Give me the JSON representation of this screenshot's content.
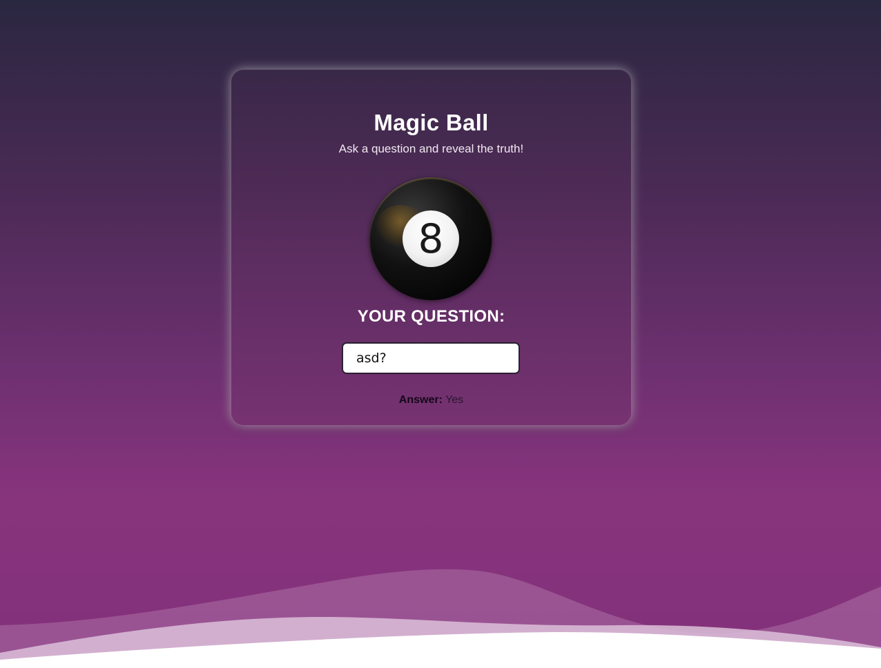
{
  "app": {
    "title": "Magic Ball",
    "subtitle": "Ask a question and reveal the truth!"
  },
  "ball": {
    "icon": "eight-ball-icon",
    "number": "8"
  },
  "question": {
    "label": "YOUR QUESTION:",
    "value": "asd?"
  },
  "answer": {
    "label": "Answer:",
    "value": "Yes"
  },
  "colors": {
    "background_top": "#2a2740",
    "background_bottom": "#88347d",
    "card_border_glow": "#ffffff",
    "text": "#ffffff"
  }
}
